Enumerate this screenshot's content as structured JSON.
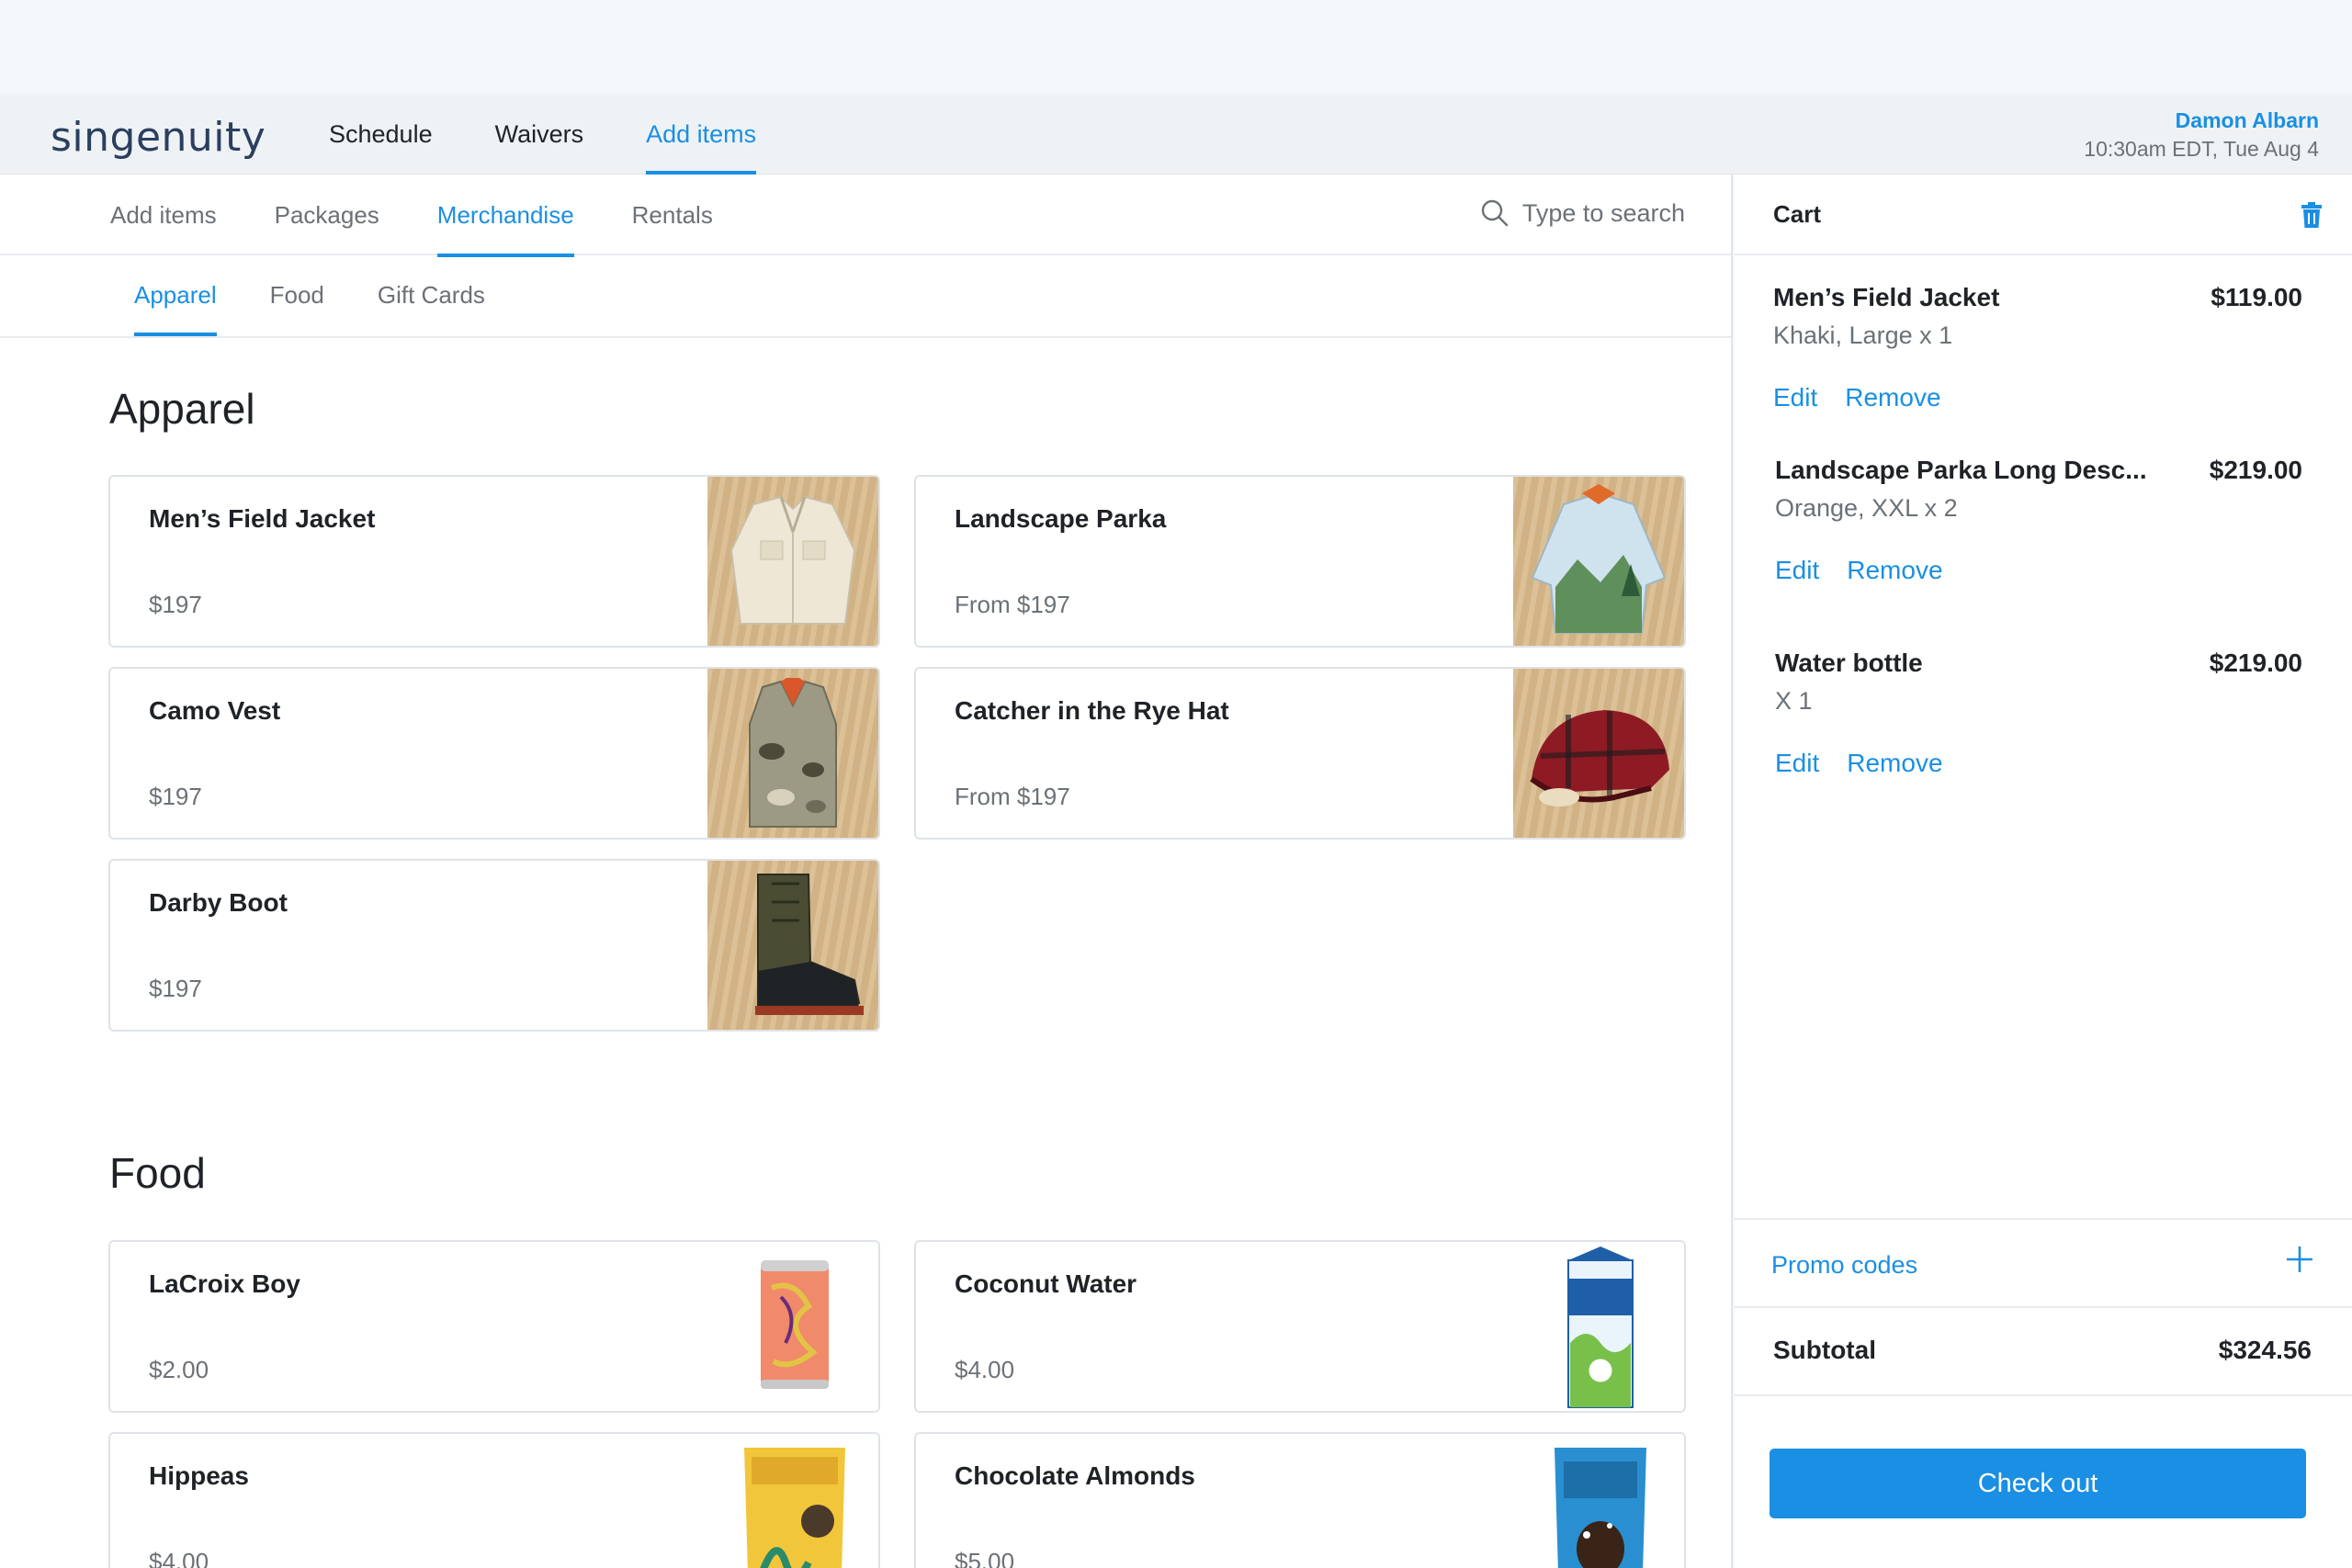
{
  "header": {
    "logo_text": "singenuity",
    "nav": [
      {
        "label": "Schedule",
        "active": false
      },
      {
        "label": "Waivers",
        "active": false
      },
      {
        "label": "Add items",
        "active": true
      }
    ],
    "user_name": "Damon Albarn",
    "datetime": "10:30am EDT, Tue Aug 4"
  },
  "subnav": {
    "tabs": [
      "Add items",
      "Packages",
      "Merchandise",
      "Rentals"
    ],
    "active": "Merchandise",
    "search_placeholder": "Type to search"
  },
  "categories": {
    "tabs": [
      "Apparel",
      "Food",
      "Gift Cards"
    ],
    "active": "Apparel"
  },
  "sections": [
    {
      "title": "Apparel",
      "items": [
        {
          "name": "Men’s Field Jacket",
          "price": "$197",
          "image": "jacket"
        },
        {
          "name": "Landscape Parka",
          "price": "From $197",
          "image": "parka"
        },
        {
          "name": "Camo Vest",
          "price": "$197",
          "image": "vest"
        },
        {
          "name": "Catcher in the Rye Hat",
          "price": "From $197",
          "image": "hat"
        },
        {
          "name": "Darby Boot",
          "price": "$197",
          "image": "boot"
        }
      ]
    },
    {
      "title": "Food",
      "items": [
        {
          "name": "LaCroix Boy",
          "price": "$2.00",
          "image": "can"
        },
        {
          "name": "Coconut Water",
          "price": "$4.00",
          "image": "carton"
        },
        {
          "name": "Hippeas",
          "price": "$4.00",
          "image": "snack-bag"
        },
        {
          "name": "Chocolate Almonds",
          "price": "$5.00",
          "image": "snack-bag-blue"
        }
      ]
    }
  ],
  "cart": {
    "title": "Cart",
    "items": [
      {
        "name": "Men’s Field Jacket",
        "price": "$119.00",
        "desc": "Khaki, Large x 1"
      },
      {
        "name": "Landscape Parka Long Desc...",
        "price": "$219.00",
        "desc": "Orange, XXL x 2"
      },
      {
        "name": "Water bottle",
        "price": "$219.00",
        "desc": "X 1"
      }
    ],
    "edit_label": "Edit",
    "remove_label": "Remove",
    "promo_label": "Promo codes",
    "subtotal_label": "Subtotal",
    "subtotal_value": "$324.56",
    "checkout_label": "Check out"
  },
  "colors": {
    "accent": "#1a8fe3",
    "text": "#1f2328",
    "muted": "#6b7177"
  }
}
